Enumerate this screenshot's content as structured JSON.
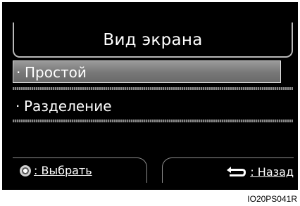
{
  "screen": {
    "title": "Вид экрана",
    "menu": [
      {
        "bullet": "·",
        "label": "Простой",
        "selected": true
      },
      {
        "bullet": "·",
        "label": "Разделение",
        "selected": false
      }
    ],
    "footer": {
      "select_label": ": Выбрать",
      "back_label": ": Назад"
    }
  },
  "caption": "IO20PS041R"
}
